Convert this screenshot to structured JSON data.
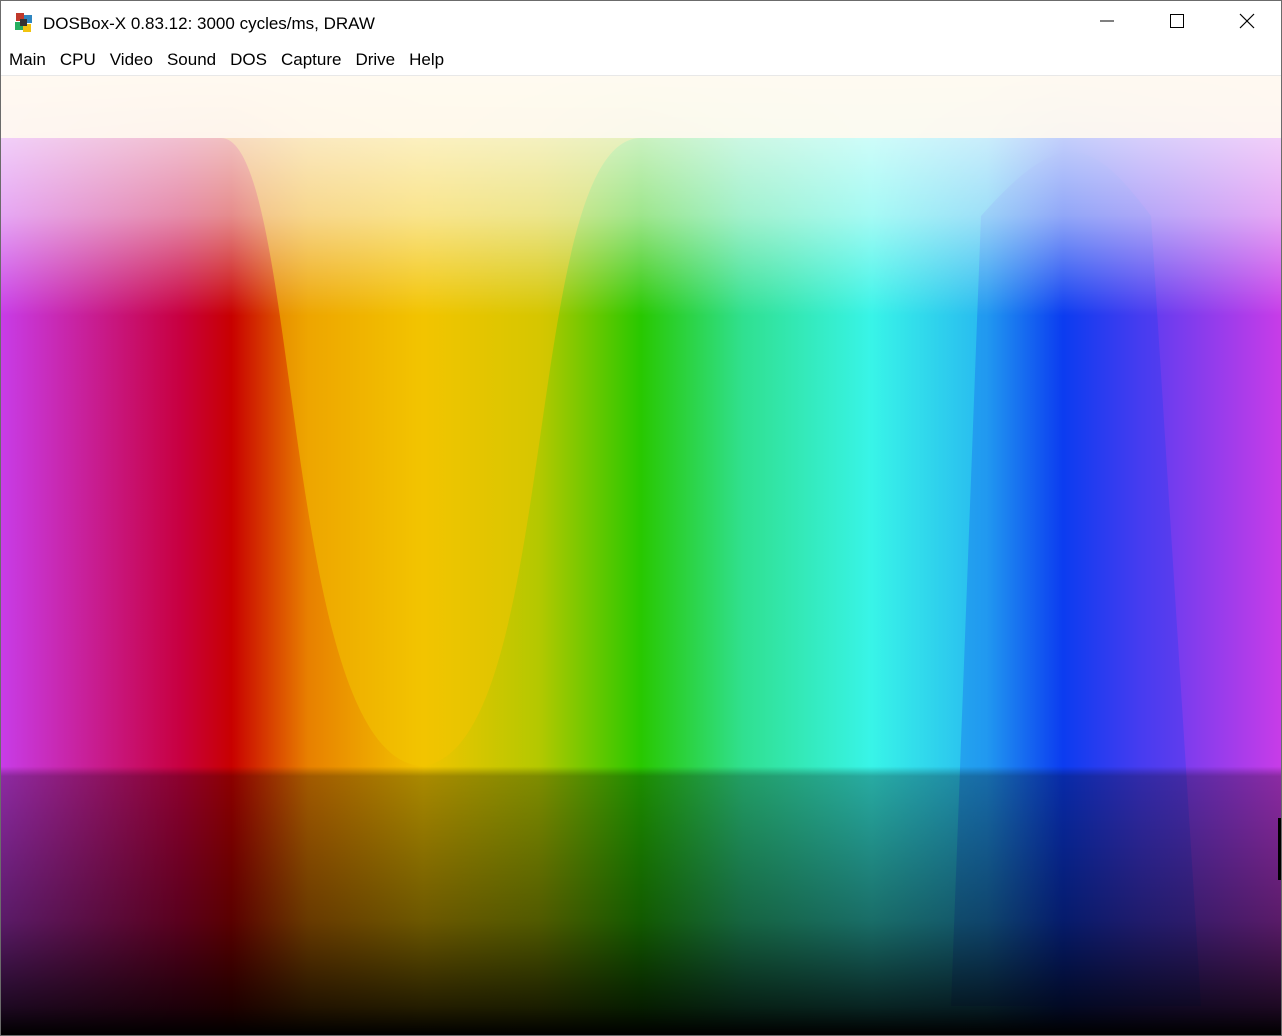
{
  "window": {
    "title": "DOSBox-X 0.83.12: 3000 cycles/ms, DRAW",
    "icon": "dosbox-x-logo-icon",
    "controls": {
      "minimize": "minimize-icon",
      "maximize": "maximize-icon",
      "close": "close-icon"
    }
  },
  "menu": {
    "items": [
      {
        "label": "Main"
      },
      {
        "label": "CPU"
      },
      {
        "label": "Video"
      },
      {
        "label": "Sound"
      },
      {
        "label": "DOS"
      },
      {
        "label": "Capture"
      },
      {
        "label": "Drive"
      },
      {
        "label": "Help"
      }
    ]
  },
  "screen": {
    "content": "vga-palette-color-pattern",
    "colors": {
      "red": "#c80000",
      "orange": "#e88000",
      "yellow": "#f2c400",
      "lime": "#b4c800",
      "green": "#28c800",
      "spring": "#30e090",
      "cyan": "#38f4e8",
      "azure": "#28b8f0",
      "blue": "#0c3cf0",
      "violet": "#5a3cf0",
      "magenta": "#c83ce8"
    }
  }
}
